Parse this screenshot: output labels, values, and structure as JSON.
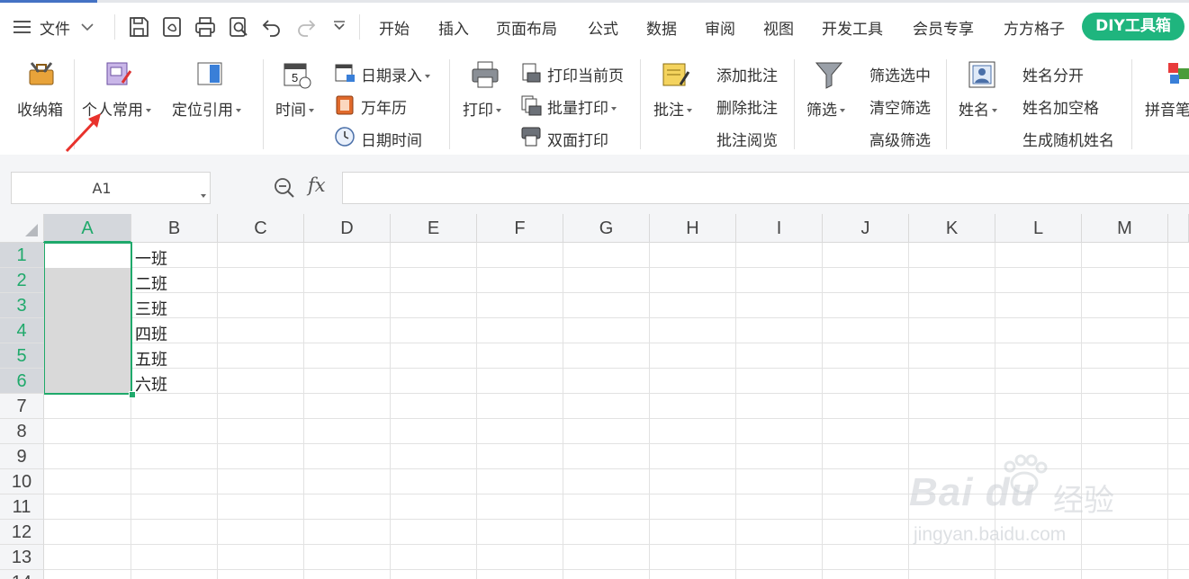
{
  "menubar": {
    "file_label": "文件",
    "tabs": [
      "开始",
      "插入",
      "页面布局",
      "公式",
      "数据",
      "审阅",
      "视图",
      "开发工具",
      "会员专享",
      "方方格子"
    ],
    "active_tab": "DIY工具箱"
  },
  "ribbon": {
    "toolbox": "收纳箱",
    "personal": "个人常用",
    "locate_ref": "定位引用",
    "time": "时间",
    "date_entry": "日期录入",
    "calendar": "万年历",
    "datetime": "日期时间",
    "print": "打印",
    "print_current": "打印当前页",
    "batch_print": "批量打印",
    "duplex_print": "双面打印",
    "comment": "批注",
    "add_comment": "添加批注",
    "delete_comment": "删除批注",
    "view_comment": "批注阅览",
    "filter": "筛选",
    "filter_selected": "筛选选中",
    "clear_filter": "清空筛选",
    "advanced_filter": "高级筛选",
    "name": "姓名",
    "split_name": "姓名分开",
    "name_space": "姓名加空格",
    "random_name": "生成随机姓名",
    "pinyin": "拼音笔"
  },
  "formula_bar": {
    "cell_ref": "A1",
    "fx": "fx",
    "value": ""
  },
  "sheet": {
    "columns": [
      "A",
      "B",
      "C",
      "D",
      "E",
      "F",
      "G",
      "H",
      "I",
      "J",
      "K",
      "L",
      "M"
    ],
    "rows": [
      "1",
      "2",
      "3",
      "4",
      "5",
      "6",
      "7",
      "8",
      "9",
      "10",
      "11",
      "12",
      "13",
      "14"
    ],
    "col_b_values": [
      "一班",
      "二班",
      "三班",
      "四班",
      "五班",
      "六班"
    ]
  },
  "watermark": {
    "brand": "Bai du",
    "cn": "经验",
    "url": "jingyan.baidu.com"
  },
  "colors": {
    "accent_green": "#1fb57e",
    "arrow_red": "#e8322c",
    "selection_green": "#1fa96b"
  }
}
